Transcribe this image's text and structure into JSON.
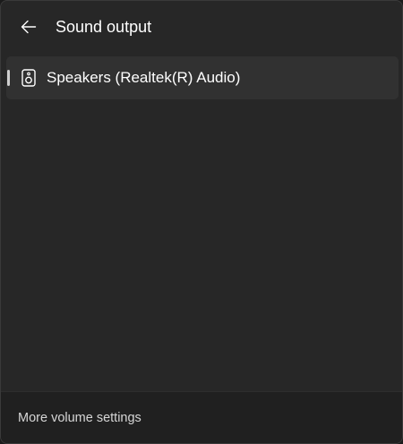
{
  "header": {
    "back_icon": "back-arrow-icon",
    "title": "Sound output"
  },
  "devices": [
    {
      "icon": "speaker-icon",
      "label": "Speakers (Realtek(R) Audio)",
      "selected": true
    }
  ],
  "footer": {
    "more_settings_label": "More volume settings"
  },
  "colors": {
    "panel_background": "#272727",
    "footer_background": "#202020",
    "selected_item_background": "#313131",
    "selection_indicator": "#cfcfcf",
    "text_primary": "#ffffff",
    "text_secondary": "#d6d6d6"
  }
}
